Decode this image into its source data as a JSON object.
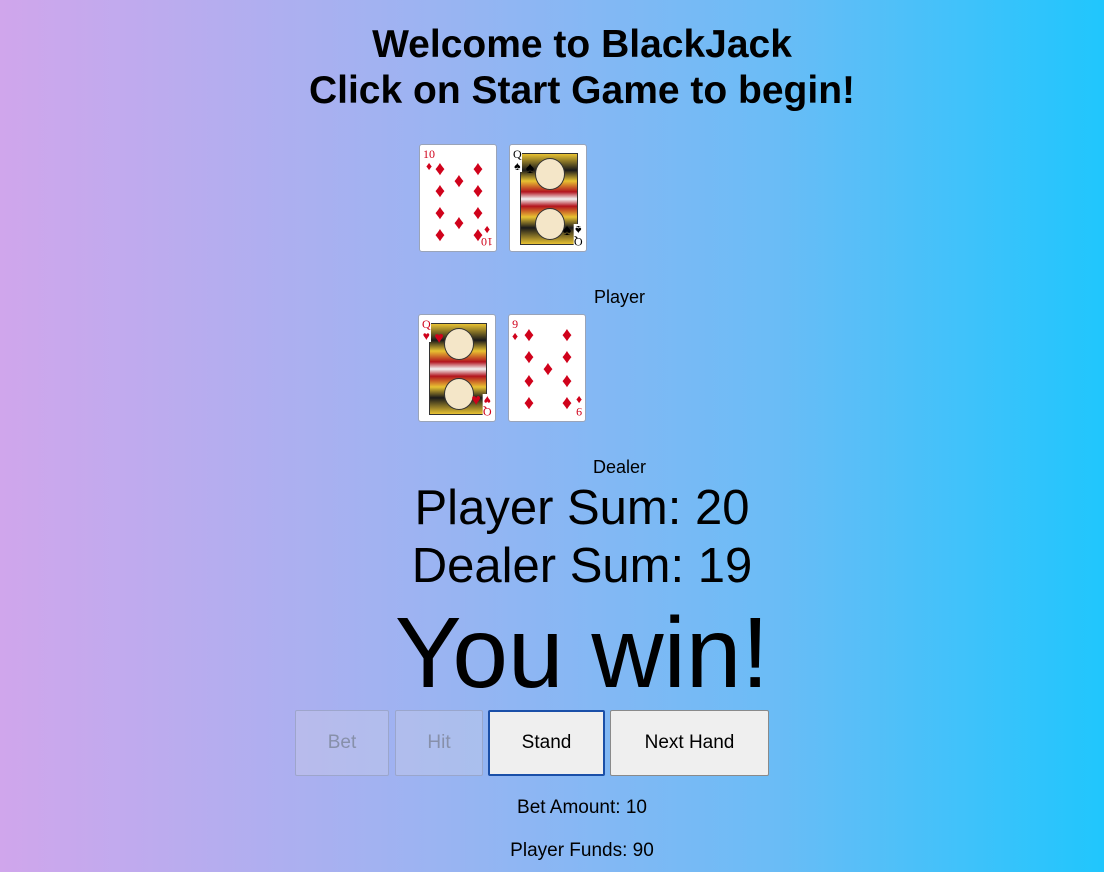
{
  "header": {
    "line1": "Welcome to BlackJack",
    "line2": "Click on Start Game to begin!"
  },
  "player": {
    "label": "Player",
    "cards": [
      {
        "rank": "10",
        "suit": "♦",
        "color": "red"
      },
      {
        "rank": "Q",
        "suit": "♠",
        "color": "black"
      }
    ]
  },
  "dealer": {
    "label": "Dealer",
    "cards": [
      {
        "rank": "Q",
        "suit": "♥",
        "color": "red"
      },
      {
        "rank": "9",
        "suit": "♦",
        "color": "red"
      }
    ]
  },
  "sums": {
    "player": "Player Sum: 20",
    "dealer": "Dealer Sum: 19"
  },
  "result": "You win!",
  "buttons": {
    "bet": "Bet",
    "hit": "Hit",
    "stand": "Stand",
    "next_hand": "Next Hand"
  },
  "info": {
    "bet_amount": "Bet Amount: 10",
    "player_funds": "Player Funds: 90"
  },
  "colors": {
    "red_suit": "#d0021b",
    "focus_ring": "#1a4fa8"
  }
}
